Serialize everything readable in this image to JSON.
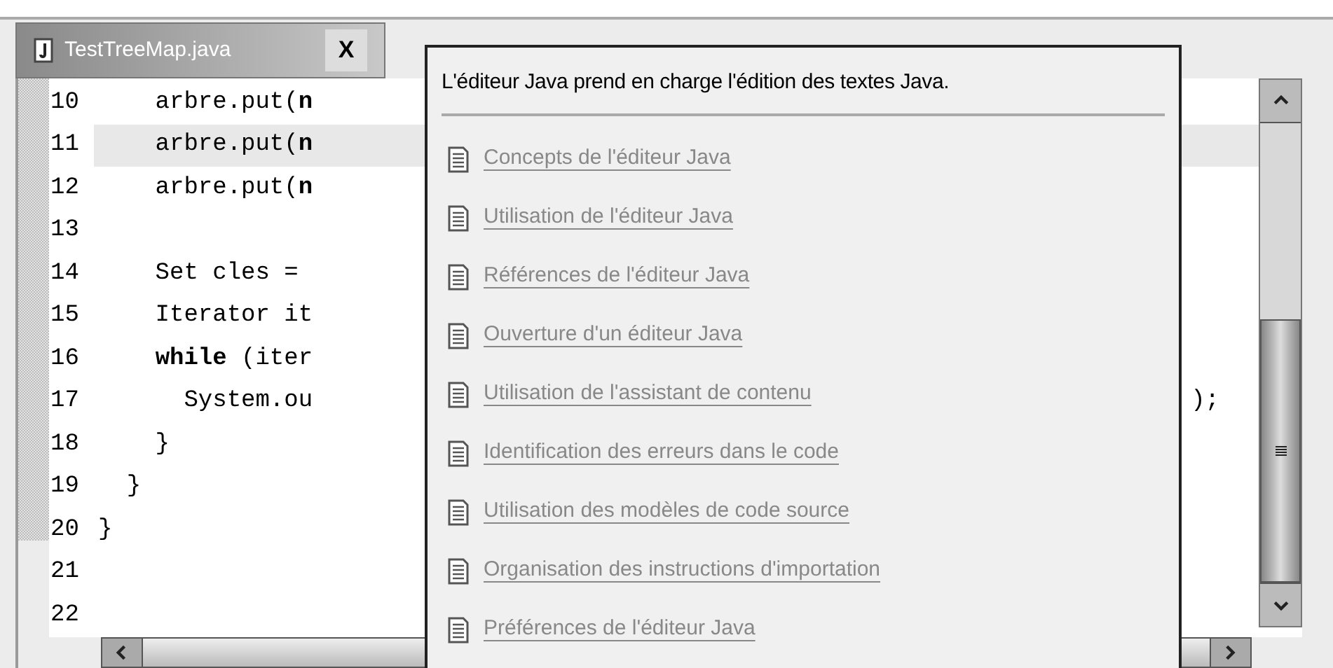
{
  "tab": {
    "title": "TestTreeMap.java",
    "close": "X"
  },
  "code_lines": [
    {
      "number": "10",
      "text": "    arbre.put(**n**",
      "current": false
    },
    {
      "number": "11",
      "text": "    arbre.put(**n**",
      "current": true
    },
    {
      "number": "12",
      "text": "    arbre.put(**n**",
      "current": false
    },
    {
      "number": "13",
      "current": false
    },
    {
      "number": "14",
      "text": "    Set cles = ",
      "current": false
    },
    {
      "number": "15",
      "text": "    Iterator it",
      "current": false
    },
    {
      "number": "16",
      "text": "    **while** (iter",
      "current": false
    },
    {
      "number": "17",
      "text": "      System.ou",
      "tail": ");",
      "current": false
    },
    {
      "number": "18",
      "text": "    }",
      "current": false
    },
    {
      "number": "19",
      "text": "  }",
      "current": false
    },
    {
      "number": "20",
      "text": "}",
      "current": false
    },
    {
      "number": "21",
      "current": false
    },
    {
      "number": "22",
      "current": false
    }
  ],
  "popup": {
    "title": "L'éditeur Java prend en charge l'édition des textes Java.",
    "links": [
      "Concepts de l'éditeur Java",
      "Utilisation de l'éditeur Java",
      "Références de l'éditeur Java",
      "Ouverture d'un éditeur Java",
      "Utilisation de l'assistant de contenu",
      "Identification des erreurs dans le code",
      "Utilisation des modèles de code source",
      "Organisation des instructions d'importation",
      "Préférences de l'éditeur Java"
    ]
  }
}
